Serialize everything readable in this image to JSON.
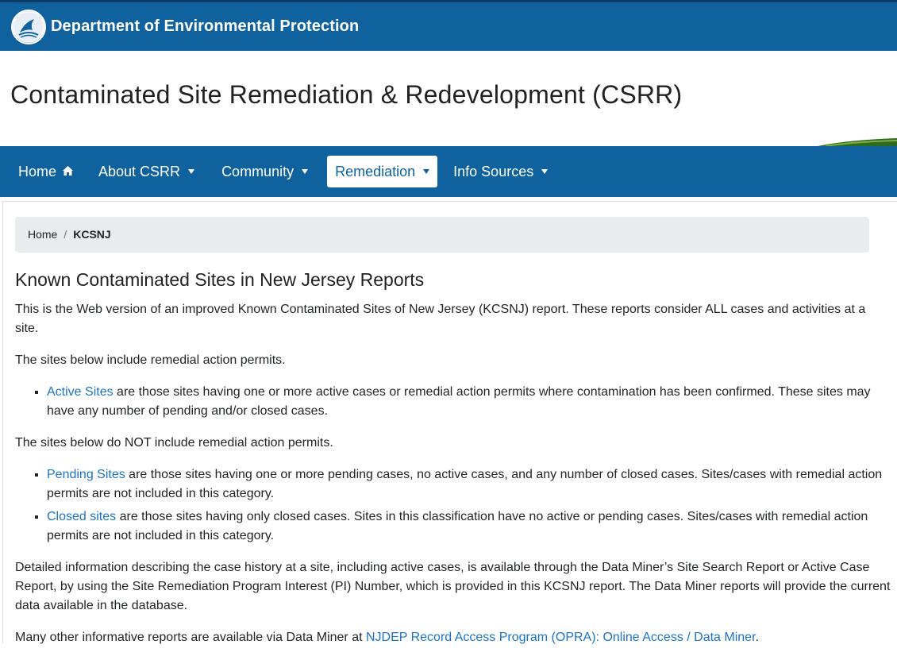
{
  "header": {
    "department": "Department of Environmental Protection",
    "site_title": "Contaminated Site Remediation & Redevelopment (CSRR)",
    "seal_icon": "nj-seal-icon"
  },
  "nav": {
    "items": [
      {
        "label": "Home",
        "icon": "home-icon"
      },
      {
        "label": "About CSRR",
        "icon": "caret-down-icon"
      },
      {
        "label": "Community",
        "icon": "caret-down-icon"
      },
      {
        "label": "Remediation",
        "icon": "caret-down-icon",
        "active": true
      },
      {
        "label": "Info Sources",
        "icon": "caret-down-icon"
      }
    ]
  },
  "breadcrumb": {
    "home": "Home",
    "separator": "/",
    "current": "KCSNJ"
  },
  "main": {
    "title": "Known Contaminated Sites in New Jersey Reports",
    "intro": "This is the Web version of an improved Known Contaminated Sites of New Jersey (KCSNJ) report. These reports consider ALL cases and activities at a site.",
    "with_permits_intro": "The sites below include remedial action permits.",
    "active": {
      "link": "Active Sites",
      "text": " are those sites having one or more active cases or remedial action permits where contamination has been confirmed. These sites may have any number of pending and/or closed cases."
    },
    "without_permits_intro": "The sites below do NOT include remedial action permits.",
    "pending": {
      "link": "Pending Sites",
      "text": " are those sites having one or more pending cases, no active cases, and any number of closed cases. Sites/cases with remedial action permits are not included in this category."
    },
    "closed": {
      "link": "Closed sites",
      "text": " are those sites having only closed cases. Sites in this classification have no active or pending cases. Sites/cases with remedial action permits are not included in this category."
    },
    "detail": "Detailed information describing the case history at a site, including active cases, is available through the Data Miner’s Site Search Report or Active Case Report, by using the Site Remediation Program Interest (PI) Number, which is provided in this KCSNJ report. The Data Miner reports will provide the current data available in the database.",
    "other_prefix": "Many other informative reports are available via Data Miner at ",
    "other_link": "NJDEP Record Access Program (OPRA): Online Access / Data Miner",
    "other_suffix": "."
  },
  "colors": {
    "brand_blue": "#0f629e",
    "link_blue": "#1a73c6",
    "breadcrumb_bg": "#e9ecef"
  }
}
